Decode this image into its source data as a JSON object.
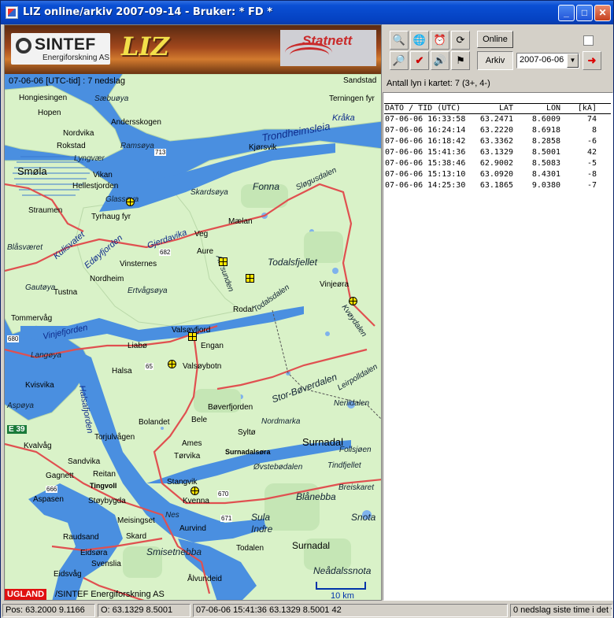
{
  "window": {
    "title": "LIZ online/arkiv  2007-09-14 - Bruker: * FD *"
  },
  "banner": {
    "sintef_name": "SINTEF",
    "sintef_sub": "Energiforskning AS",
    "liz_logo": "LIZ",
    "statnett_logo": "Statnett"
  },
  "map": {
    "header": "07-06-06 [UTC-tid] : 7 nedslag",
    "places": [
      "Sandstad",
      "Terningen fyr",
      "Hongiesingen",
      "Sæbuøya",
      "Hopen",
      "Andersskogen",
      "Nordvika",
      "Rokstad",
      "Ramsøya",
      "Lyngvær",
      "Kjørsvik",
      "Vikan",
      "Hellestjorden",
      "Glassøya",
      "Skardsøya",
      "Fonna",
      "Straumen",
      "Tyrhaug fyr",
      "Mælan",
      "Veg",
      "Blåsværet",
      "Aure",
      "Todalsfjellet",
      "Vinsternes",
      "Nordheim",
      "Gautøya",
      "Tustna",
      "Ertvågsøya",
      "Vinjeøra",
      "Tommervåg",
      "Rodal",
      "Valsøyfjord",
      "Liabø",
      "Engan",
      "Langøya",
      "Halsa",
      "Valsøybotn",
      "Kvisvika",
      "Aspøya",
      "Bøverfjorden",
      "Bolandet",
      "Bele",
      "Syltø",
      "Torjulvågen",
      "Kvalvåg",
      "Ames",
      "Surnadal",
      "Tørvika",
      "Surnadalsøra",
      "Sandvika",
      "Gagnett",
      "Reitan",
      "Tingvoll",
      "Tindfjellet",
      "Øvstebødalen",
      "Støybygda",
      "Stangvik",
      "Aspasen",
      "Kvenna",
      "Breiskaret",
      "Blånebba",
      "Meisingset",
      "Sula",
      "Indre",
      "Snota",
      "Raudsand",
      "Skard",
      "Aurvind",
      "Smisetnebba",
      "Eidsøra",
      "Svenslia",
      "Todalen",
      "Surnadal",
      "Eidsvåg",
      "Neådalssnota",
      "Ålvundeid",
      "Nordmarka",
      "Nerlidalen",
      "Leirpolldalen",
      "Follsjøen",
      "Nes",
      "Sløgusdalen",
      "Stor-Bøverdalen",
      "Todalsdalen",
      "Kvøydalen",
      "Aursunden",
      "E 39",
      "680",
      "682",
      "65",
      "670",
      "671",
      "666",
      "713"
    ],
    "waters": [
      "Trondheimsleia",
      "Kråka",
      "Smøla",
      "Kulisvatet",
      "Edøyfjorden",
      "Gjerdavika",
      "Vinjefjorden",
      "Halsafjorden",
      "Stor-Bøverdalen"
    ],
    "scale_label": "10 km",
    "ugland": "UGLAND",
    "copyright": "/SINTEF Energiforskning AS"
  },
  "toolbar": {
    "online_label": "Online",
    "arkiv_label": "Arkiv",
    "date_value": "2007-06-06",
    "checkbox_checked": false,
    "tools": [
      "zoom-in-icon",
      "globe-icon",
      "alarm-clock-icon",
      "refresh-icon",
      "zoom-out-icon",
      "checkmark-icon",
      "speaker-icon",
      "signpost-icon",
      "red-arrow-icon"
    ]
  },
  "lightning": {
    "count_line": "Antall lyn i kartet: 7 (3+, 4-)",
    "columns": [
      "DATO / TID  (UTC)",
      "LAT",
      "LON",
      "[kA]"
    ],
    "rows": [
      [
        "07-06-06 16:33:58",
        "63.2471",
        "8.6009",
        "74"
      ],
      [
        "07-06-06 16:24:14",
        "63.2220",
        "8.6918",
        "8"
      ],
      [
        "07-06-06 16:18:42",
        "63.3362",
        "8.2858",
        "-6"
      ],
      [
        "07-06-06 15:41:36",
        "63.1329",
        "8.5001",
        "42"
      ],
      [
        "07-06-06 15:38:46",
        "62.9002",
        "8.5083",
        "-5"
      ],
      [
        "07-06-06 15:13:10",
        "63.0920",
        "8.4301",
        "-8"
      ],
      [
        "07-06-06 14:25:30",
        "63.1865",
        "9.0380",
        "-7"
      ]
    ]
  },
  "status": {
    "pos": "Pos: 63.2000  9.1166",
    "o": "O: 63.1329  8.5001",
    "strike": "07-06-06 15:41:36 63.1329  8.5001   42",
    "info": "0 nedslag siste time i det v"
  },
  "colors": {
    "titlebar": "#0542c2",
    "water": "#4a8fe0",
    "land": "#d9f2c8",
    "road": "#e05050",
    "strike": "#ffe600"
  }
}
